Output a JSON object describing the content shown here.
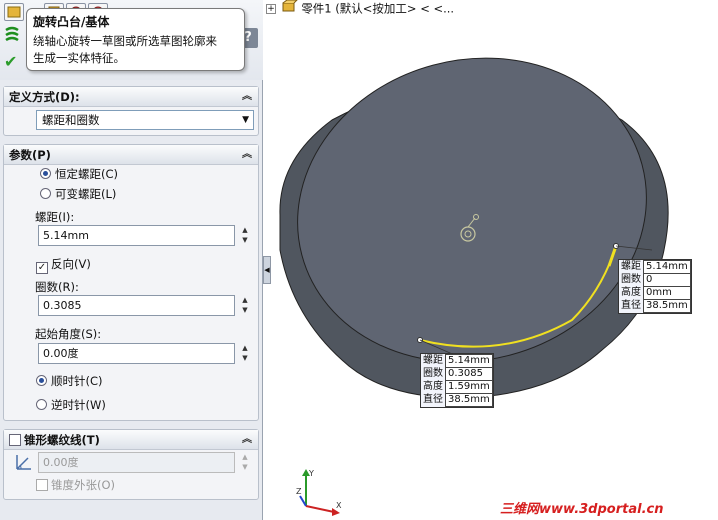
{
  "tooltip": {
    "title": "旋转凸台/基体",
    "line1": "绕轴心旋转一草图或所选草图轮廓来",
    "line2": "生成一实体特征。"
  },
  "help_label": "?",
  "define_group": {
    "header": "定义方式(D):",
    "selected": "螺距和圈数"
  },
  "params_group": {
    "header": "参数(P)",
    "radio_const_pitch": "恒定螺距(C)",
    "radio_var_pitch": "可变螺距(L)",
    "pitch_label": "螺距(I):",
    "pitch_value": "5.14mm",
    "reverse_label": "反向(V)",
    "turns_label": "圈数(R):",
    "turns_value": "0.3085",
    "start_angle_label": "起始角度(S):",
    "start_angle_value": "0.00度",
    "radio_cw": "顺时针(C)",
    "radio_ccw": "逆时针(W)"
  },
  "taper_group": {
    "header": "锥形螺纹线(T)",
    "angle_value": "0.00度",
    "outward_label": "锥度外张(O)"
  },
  "tree": {
    "root_label": "零件1  (默认<按加工> < <..."
  },
  "callout_right": {
    "rows": [
      {
        "k": "螺距",
        "v": "5.14mm"
      },
      {
        "k": "圈数",
        "v": "0"
      },
      {
        "k": "高度",
        "v": "0mm"
      },
      {
        "k": "直径",
        "v": "38.5mm"
      }
    ]
  },
  "callout_bottom": {
    "rows": [
      {
        "k": "螺距",
        "v": "5.14mm"
      },
      {
        "k": "圈数",
        "v": "0.3085"
      },
      {
        "k": "高度",
        "v": "1.59mm"
      },
      {
        "k": "直径",
        "v": "38.5mm"
      }
    ]
  },
  "watermark": "三维网www.3dportal.cn",
  "colors": {
    "cylinder": "#585e6a",
    "helix": "#f0e020",
    "accent": "#2a4f9a"
  }
}
